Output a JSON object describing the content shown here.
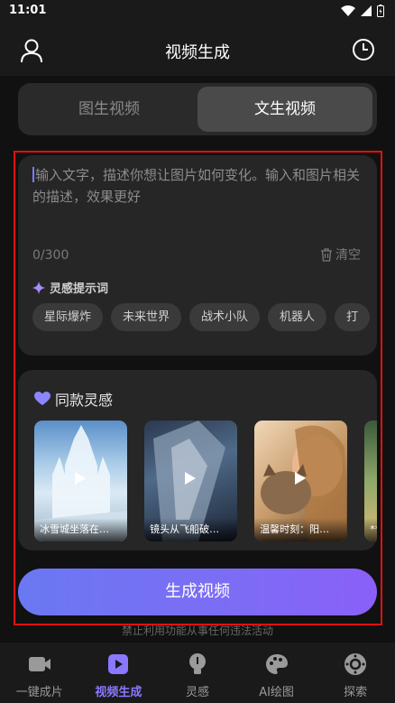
{
  "status_bar": {
    "time": "11:01"
  },
  "header": {
    "title": "视频生成"
  },
  "tabs": [
    {
      "label": "图生视频",
      "active": false
    },
    {
      "label": "文生视频",
      "active": true
    }
  ],
  "prompt": {
    "placeholder": "输入文字，描述你想让图片如何变化。输入和图片相关的描述，效果更好",
    "counter": "0/300",
    "clear_label": "清空",
    "inspiration_title": "灵感提示词",
    "chips": [
      "星际爆炸",
      "未来世界",
      "战术小队",
      "机器人",
      "打"
    ]
  },
  "similar": {
    "title": "同款灵感",
    "items": [
      {
        "caption": "冰雪城坐落在…"
      },
      {
        "caption": "镜头从飞船破…"
      },
      {
        "caption": "温馨时刻：阳…"
      },
      {
        "caption": "**皮"
      }
    ]
  },
  "generate": {
    "label": "生成视频"
  },
  "disclaimer": "禁止利用功能从事任何违法活动",
  "nav": [
    {
      "label": "一键成片",
      "icon": "video-camera-icon",
      "active": false
    },
    {
      "label": "视频生成",
      "icon": "play-square-icon",
      "active": true
    },
    {
      "label": "灵感",
      "icon": "lightbulb-icon",
      "active": false
    },
    {
      "label": "AI绘图",
      "icon": "palette-icon",
      "active": false
    },
    {
      "label": "探索",
      "icon": "compass-icon",
      "active": false
    }
  ],
  "colors": {
    "accent": "#8a78ff",
    "frame": "#e01010",
    "button_start": "#6a78f2",
    "button_end": "#8a60f8"
  }
}
